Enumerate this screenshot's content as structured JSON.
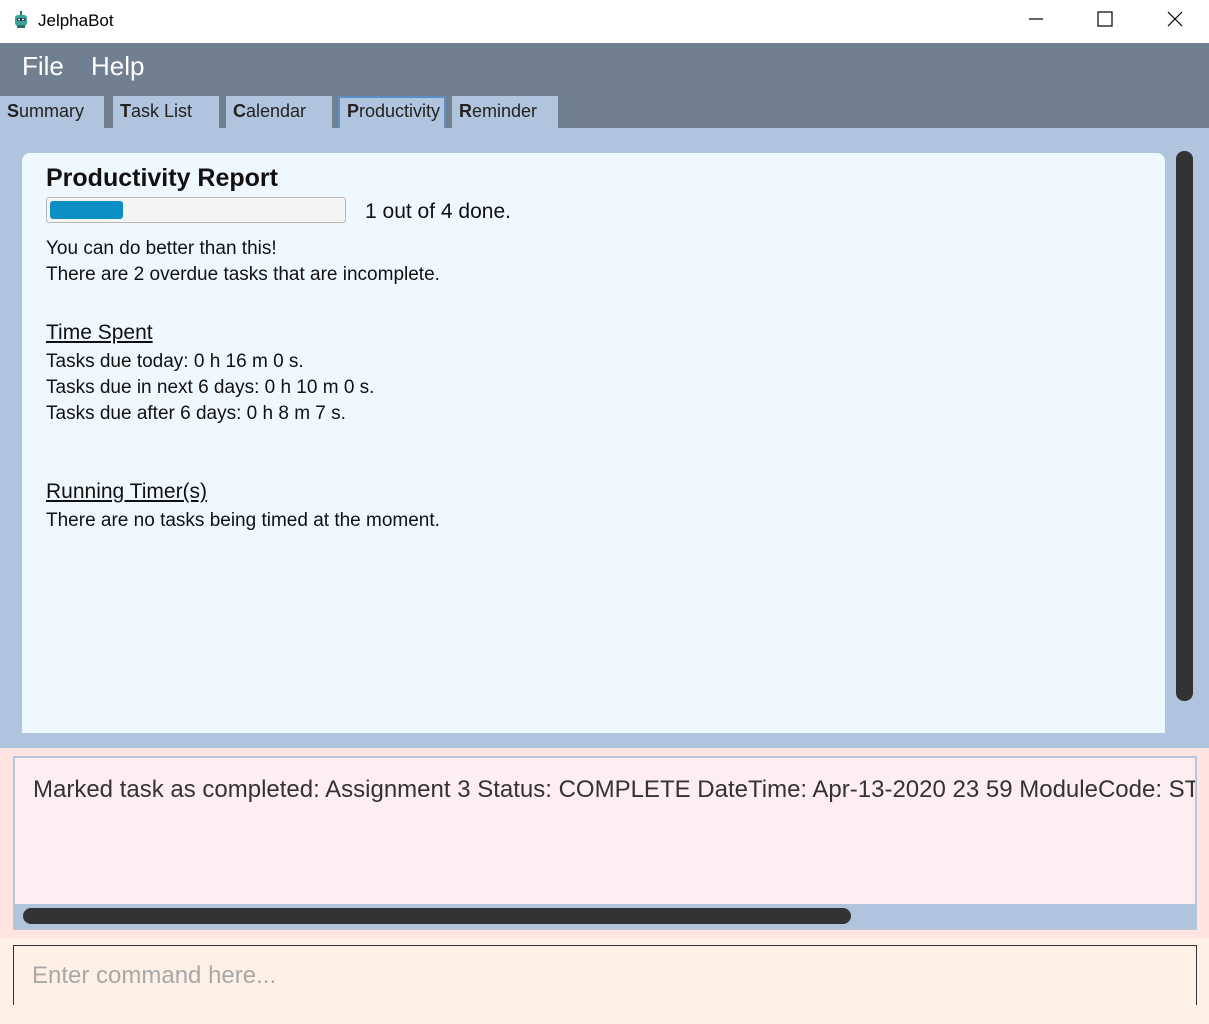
{
  "window": {
    "title": "JelphaBot",
    "app_icon": "robot-icon",
    "controls": [
      "minimize-icon",
      "maximize-icon",
      "close-icon"
    ]
  },
  "menu": {
    "file": "File",
    "help": "Help"
  },
  "tabs": [
    {
      "mnemonic": "S",
      "rest": "ummary"
    },
    {
      "mnemonic": "T",
      "rest": "ask List"
    },
    {
      "mnemonic": "C",
      "rest": "alendar"
    },
    {
      "mnemonic": "P",
      "rest": "roductivity"
    },
    {
      "mnemonic": "R",
      "rest": "eminder"
    }
  ],
  "active_tab": "Productivity",
  "report": {
    "title": "Productivity Report",
    "progress_fraction": 0.25,
    "progress_text": "1 out of 4 done.",
    "message": "You can do better than this!",
    "overdue": "There are 2 overdue tasks that are incomplete.",
    "time_spent_heading": "Time Spent",
    "due_today": "Tasks due today: 0 h 16 m 0 s.",
    "due_next": "Tasks due in next 6 days: 0 h 10 m 0 s.",
    "due_after": "Tasks due after 6 days: 0 h 8 m 7 s.",
    "running_heading": "Running Timer(s)",
    "running_text": "There are no tasks being timed at the moment."
  },
  "result": {
    "text": "Marked task as completed: Assignment 3 Status: COMPLETE DateTime: Apr-13-2020 23 59 ModuleCode: ST"
  },
  "command": {
    "placeholder": "Enter command here..."
  },
  "colors": {
    "menubar": "#708090",
    "tab_bg": "#b0c4de",
    "card_bg": "#f0f8ff",
    "progress_fill": "#0b8fc4",
    "result_bg": "#ffe4e1",
    "command_bg": "#fff0e6"
  }
}
